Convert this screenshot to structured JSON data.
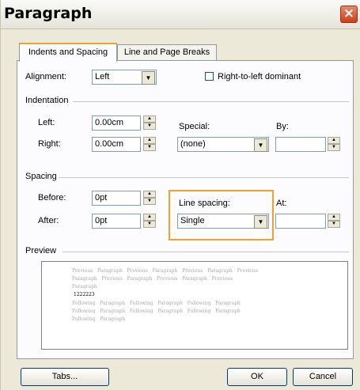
{
  "title": "Paragraph",
  "tabs": [
    {
      "label": "Indents and Spacing"
    },
    {
      "label": "Line and Page Breaks"
    }
  ],
  "alignment": {
    "label": "Alignment:",
    "value": "Left"
  },
  "rtl": {
    "label": "Right-to-left dominant",
    "checked": false
  },
  "indentation": {
    "group_label": "Indentation",
    "left_label": "Left:",
    "left_value": "0.00cm",
    "right_label": "Right:",
    "right_value": "0.00cm",
    "special_label": "Special:",
    "special_value": "(none)",
    "by_label": "By:",
    "by_value": ""
  },
  "spacing": {
    "group_label": "Spacing",
    "before_label": "Before:",
    "before_value": "0pt",
    "after_label": "After:",
    "after_value": "0pt",
    "line_spacing_label": "Line spacing:",
    "line_spacing_value": "Single",
    "at_label": "At:",
    "at_value": ""
  },
  "preview": {
    "group_label": "Preview",
    "previous_lines": [
      "Previous   Paragraph   Previous   Paragraph   Previous   Paragraph   Previous",
      "Paragraph   Previous   Paragraph   Previous   Paragraph   Previous",
      "Paragraph"
    ],
    "sample_text": "1222223",
    "following_lines": [
      "Following   Paragraph   Following   Paragraph   Following   Paragraph",
      "Following   Paragraph   Following   Paragraph   Following   Paragraph",
      "Following   Paragraph"
    ]
  },
  "buttons": {
    "tabs": "Tabs...",
    "ok": "OK",
    "cancel": "Cancel"
  },
  "icons": {
    "close": "×",
    "dropdown": "▼",
    "spin_up": "▲",
    "spin_down": "▼"
  },
  "colors": {
    "highlight": "#f0a030",
    "close_button": "#c9401a",
    "dialog_bg": "#ece9d8"
  }
}
